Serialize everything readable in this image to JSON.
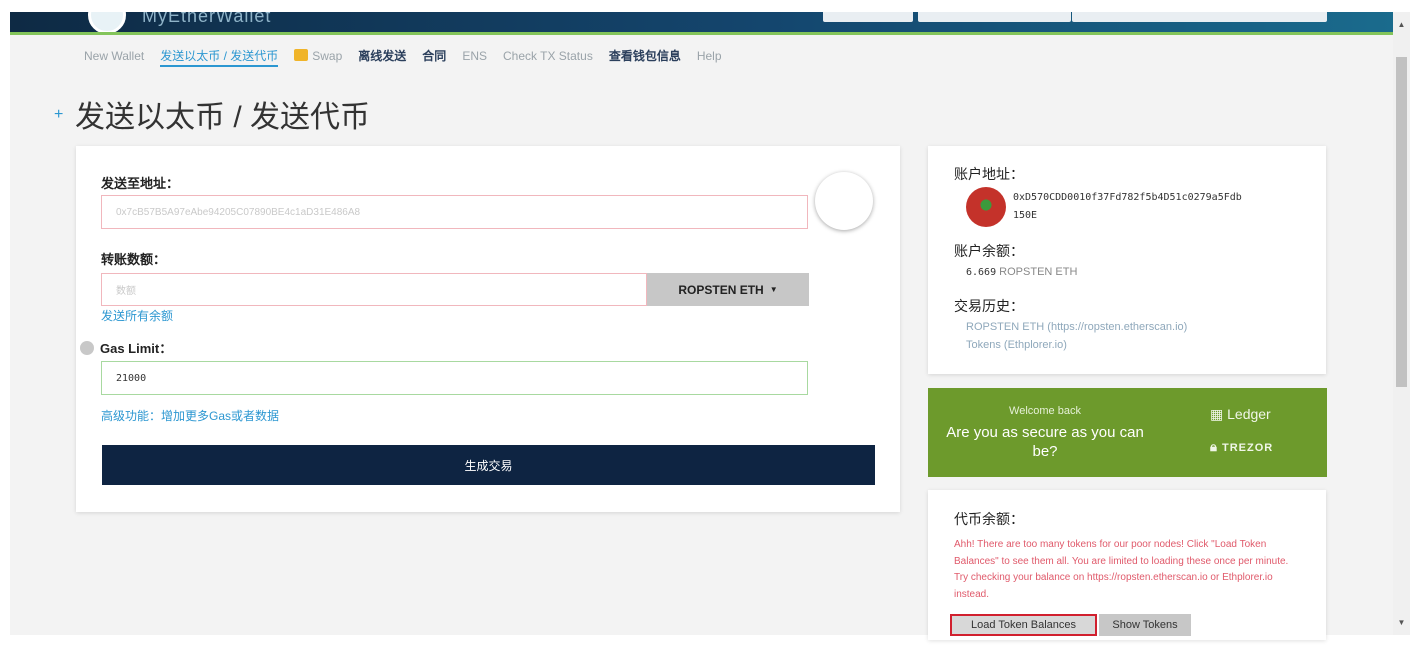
{
  "header": {
    "app_title": "MyEtherWallet"
  },
  "nav": {
    "items": [
      {
        "label": "New Wallet"
      },
      {
        "label": "发送以太币 / 发送代币"
      },
      {
        "label": "Swap"
      },
      {
        "label": "离线发送"
      },
      {
        "label": "合同"
      },
      {
        "label": "ENS"
      },
      {
        "label": "Check TX Status"
      },
      {
        "label": "查看钱包信息"
      },
      {
        "label": "Help"
      }
    ]
  },
  "page": {
    "title": "发送以太币 / 发送代币"
  },
  "form": {
    "to_label": "发送至地址：",
    "to_placeholder": "0x7cB57B5A97eAbe94205C07890BE4c1aD31E486A8",
    "amount_label": "转账数额：",
    "amount_placeholder": "数额",
    "unit_label": "ROPSTEN ETH",
    "send_all_link": "发送所有余额",
    "gas_label": "Gas Limit：",
    "gas_value": "21000",
    "advanced_link": "高级功能：增加更多Gas或者数据",
    "generate_button": "生成交易"
  },
  "account": {
    "address_label": "账户地址：",
    "address_line1": "0xD570CDD0010f37Fd782f5b4D51c0279a5Fdb",
    "address_line2": "150E",
    "balance_label": "账户余额：",
    "balance_amount": "6.669",
    "balance_unit": "ROPSTEN ETH",
    "history_label": "交易历史：",
    "history_link1": "ROPSTEN ETH (https://ropsten.etherscan.io)",
    "history_link2": "Tokens (Ethplorer.io)"
  },
  "promo": {
    "small": "Welcome back",
    "big": "Are you as secure as you can be?",
    "brand1": "Ledger",
    "brand2": "TREZOR"
  },
  "tokens": {
    "label": "代币余额：",
    "warning": "Ahh! There are too many tokens for our poor nodes! Click \"Load Token Balances\" to see them all. You are limited to loading these once per minute. Try checking your balance on https://ropsten.etherscan.io or Ethplorer.io instead.",
    "load_button": "Load Token Balances",
    "show_button": "Show Tokens"
  },
  "colors": {
    "accent": "#2c97d1",
    "primary_dark": "#0e2442",
    "promo_green": "#6d9a2c",
    "error": "#e05a6b"
  }
}
